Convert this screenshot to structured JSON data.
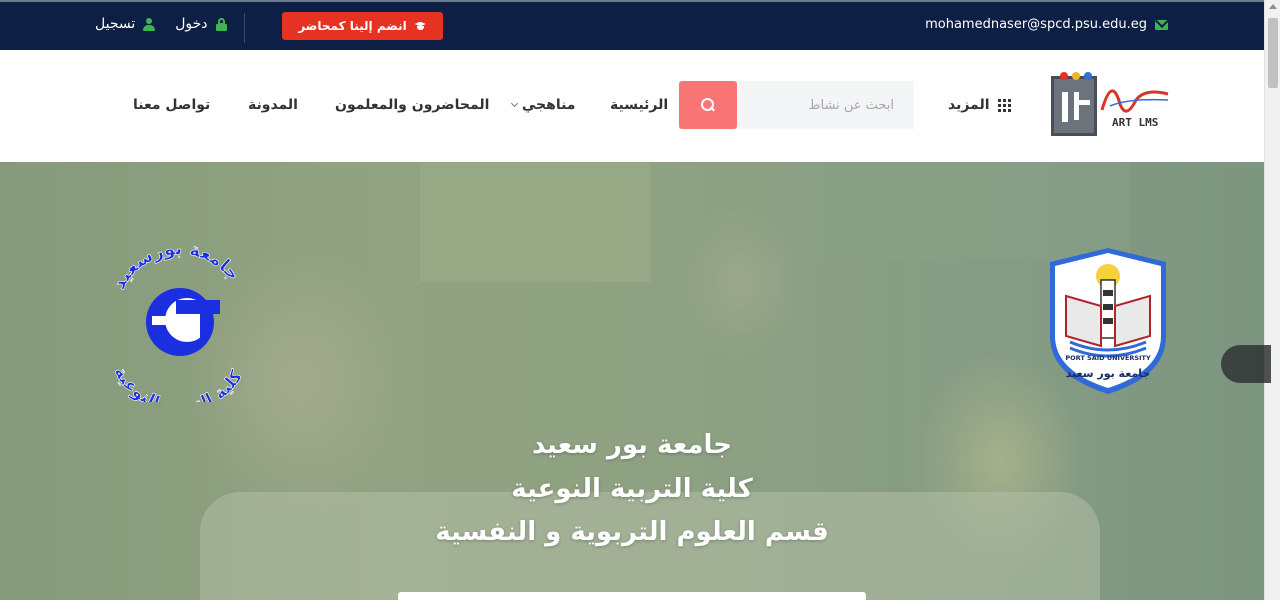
{
  "topbar": {
    "email": "mohamednaser@spcd.psu.edu.eg",
    "join_label": "انضم إلينا كمحاضر",
    "login_label": "دخول",
    "register_label": "تسجيل"
  },
  "header": {
    "logo_text": "ART LMS",
    "more_label": "المزيد",
    "search_placeholder": "ابحث عن نشاط",
    "nav": {
      "home": "الرئيسية",
      "curricula": "مناهجي",
      "instructors": "المحاضرون والمعلمون",
      "blog": "المدونة",
      "contact": "تواصل معنا"
    }
  },
  "hero": {
    "line1": "جامعة بور سعيد",
    "line2": "كلية التربية النوعية",
    "line3": "قسم العلوم التربوية و النفسية",
    "left_logo_top": "جامعة بورسعيد",
    "left_logo_bottom": "كلية التربية النوعية",
    "right_logo_en": "PORT SAID UNIVERSITY",
    "right_logo_ar": "جامعة بور سعيد"
  },
  "colors": {
    "topbar_bg": "#0d1f44",
    "accent_red": "#e53222",
    "search_button": "#f87475",
    "icon_green": "#3fb54f"
  }
}
